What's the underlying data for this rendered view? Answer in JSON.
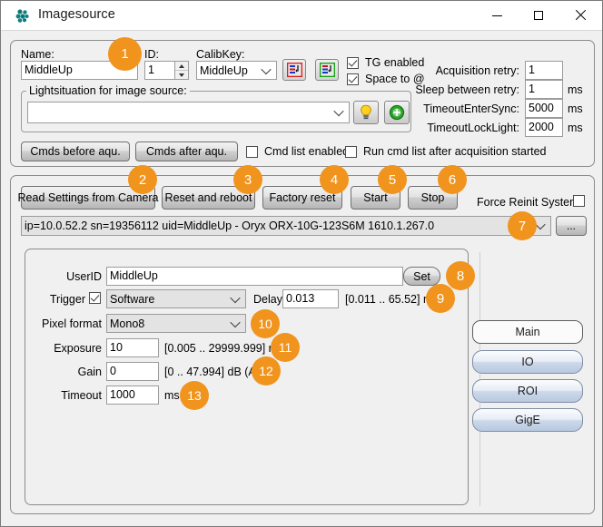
{
  "window": {
    "title": "Imagesource",
    "icon": "app-cluster-icon",
    "controls": {
      "minimize": "minimize-icon",
      "maximize": "maximize-icon",
      "close": "close-icon"
    }
  },
  "source_group": {
    "name_label": "Name:",
    "name_value": "MiddleUp",
    "id_label": "ID:",
    "id_value": "1",
    "calibkey_label": "CalibKey:",
    "calibkey_value": "MiddleUp",
    "icon_button_red": "import-red-icon",
    "icon_button_green": "export-green-icon",
    "checkboxes": [
      {
        "label": "TG enabled",
        "checked": true
      },
      {
        "label": "Space to @",
        "checked": true
      }
    ],
    "retry": [
      {
        "label": "Acquisition retry:",
        "value": "1",
        "unit": ""
      },
      {
        "label": "Sleep between retry:",
        "value": "1",
        "unit": "ms"
      },
      {
        "label": "TimeoutEnterSync:",
        "value": "5000",
        "unit": "ms"
      },
      {
        "label": "TimeoutLockLight:",
        "value": "2000",
        "unit": "ms"
      }
    ],
    "light_group_title": "Lightsituation for image source:",
    "light_value": "",
    "light_bulb_button": "lightbulb-icon",
    "light_add_button": "add-circle-icon",
    "cmds_before": "Cmds before aqu.",
    "cmds_after": "Cmds after aqu.",
    "cmd_list_enabled": {
      "label": "Cmd list enabled",
      "checked": false
    },
    "run_cmd_list": {
      "label": "Run cmd list after acquisition started",
      "checked": false
    }
  },
  "camera_group": {
    "buttons": [
      "Read Settings from Camera",
      "Reset and reboot",
      "Factory reset",
      "Start",
      "Stop"
    ],
    "force_reinit": {
      "label": "Force Reinit System",
      "checked": false
    },
    "device_combo": "ip=10.0.52.2 sn=19356112 uid=MiddleUp - Oryx ORX-10G-123S6M 1610.1.267.0",
    "browse_button": "...",
    "settings": {
      "userid_label": "UserID",
      "userid_value": "MiddleUp",
      "set_button": "Set",
      "trigger_label": "Trigger",
      "trigger_checked": true,
      "trigger_value": "Software",
      "delay_label": "Delay",
      "delay_value": "0.013",
      "delay_range": "[0.011 .. 65.52] ms",
      "pixel_format_label": "Pixel format",
      "pixel_format_value": "Mono8",
      "exposure_label": "Exposure",
      "exposure_value": "10",
      "exposure_range": "[0.005 .. 29999.999] ms",
      "gain_label": "Gain",
      "gain_value": "0",
      "gain_range": "[0 .. 47.994] dB (All)",
      "timeout_label": "Timeout",
      "timeout_value": "1000",
      "timeout_unit": "ms"
    },
    "tabs": [
      {
        "label": "Main",
        "active": true
      },
      {
        "label": "IO",
        "active": false
      },
      {
        "label": "ROI",
        "active": false
      },
      {
        "label": "GigE",
        "active": false
      }
    ]
  },
  "badges": [
    {
      "n": "1"
    },
    {
      "n": "2"
    },
    {
      "n": "3"
    },
    {
      "n": "4"
    },
    {
      "n": "5"
    },
    {
      "n": "6"
    },
    {
      "n": "7"
    },
    {
      "n": "8"
    },
    {
      "n": "9"
    },
    {
      "n": "10"
    },
    {
      "n": "11"
    },
    {
      "n": "12"
    },
    {
      "n": "13"
    }
  ],
  "colors": {
    "badge": "#f0941e",
    "title_icon": "#128080",
    "window_bg": "#f0f0f0"
  }
}
